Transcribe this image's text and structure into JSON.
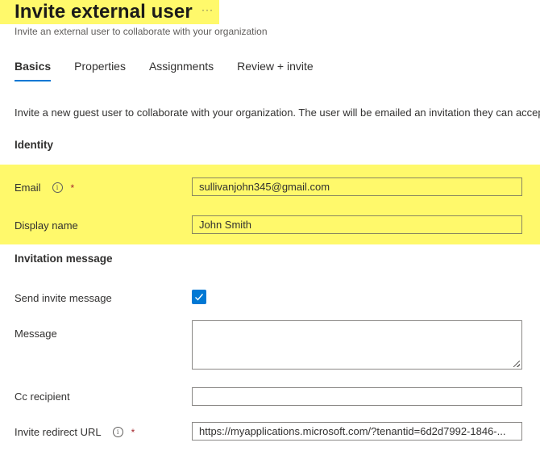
{
  "header": {
    "title": "Invite external user",
    "more_label": "···",
    "subtitle": "Invite an external user to collaborate with your organization"
  },
  "tabs": [
    {
      "label": "Basics",
      "active": true
    },
    {
      "label": "Properties",
      "active": false
    },
    {
      "label": "Assignments",
      "active": false
    },
    {
      "label": "Review + invite",
      "active": false
    }
  ],
  "intro_text": "Invite a new guest user to collaborate with your organization. The user will be emailed an invitation they can accep",
  "identity": {
    "heading": "Identity",
    "email": {
      "label": "Email",
      "required_mark": "*",
      "value": "sullivanjohn345@gmail.com"
    },
    "display_name": {
      "label": "Display name",
      "value": "John Smith"
    }
  },
  "invitation": {
    "heading": "Invitation message",
    "send_invite": {
      "label": "Send invite message",
      "checked": true
    },
    "message": {
      "label": "Message",
      "value": ""
    },
    "cc_recipient": {
      "label": "Cc recipient",
      "value": ""
    },
    "redirect_url": {
      "label": "Invite redirect URL",
      "required_mark": "*",
      "value": "https://myapplications.microsoft.com/?tenantid=6d2d7992-1846-..."
    }
  },
  "colors": {
    "accent": "#0078d4",
    "highlight": "#fff96b",
    "required": "#a4262c"
  }
}
